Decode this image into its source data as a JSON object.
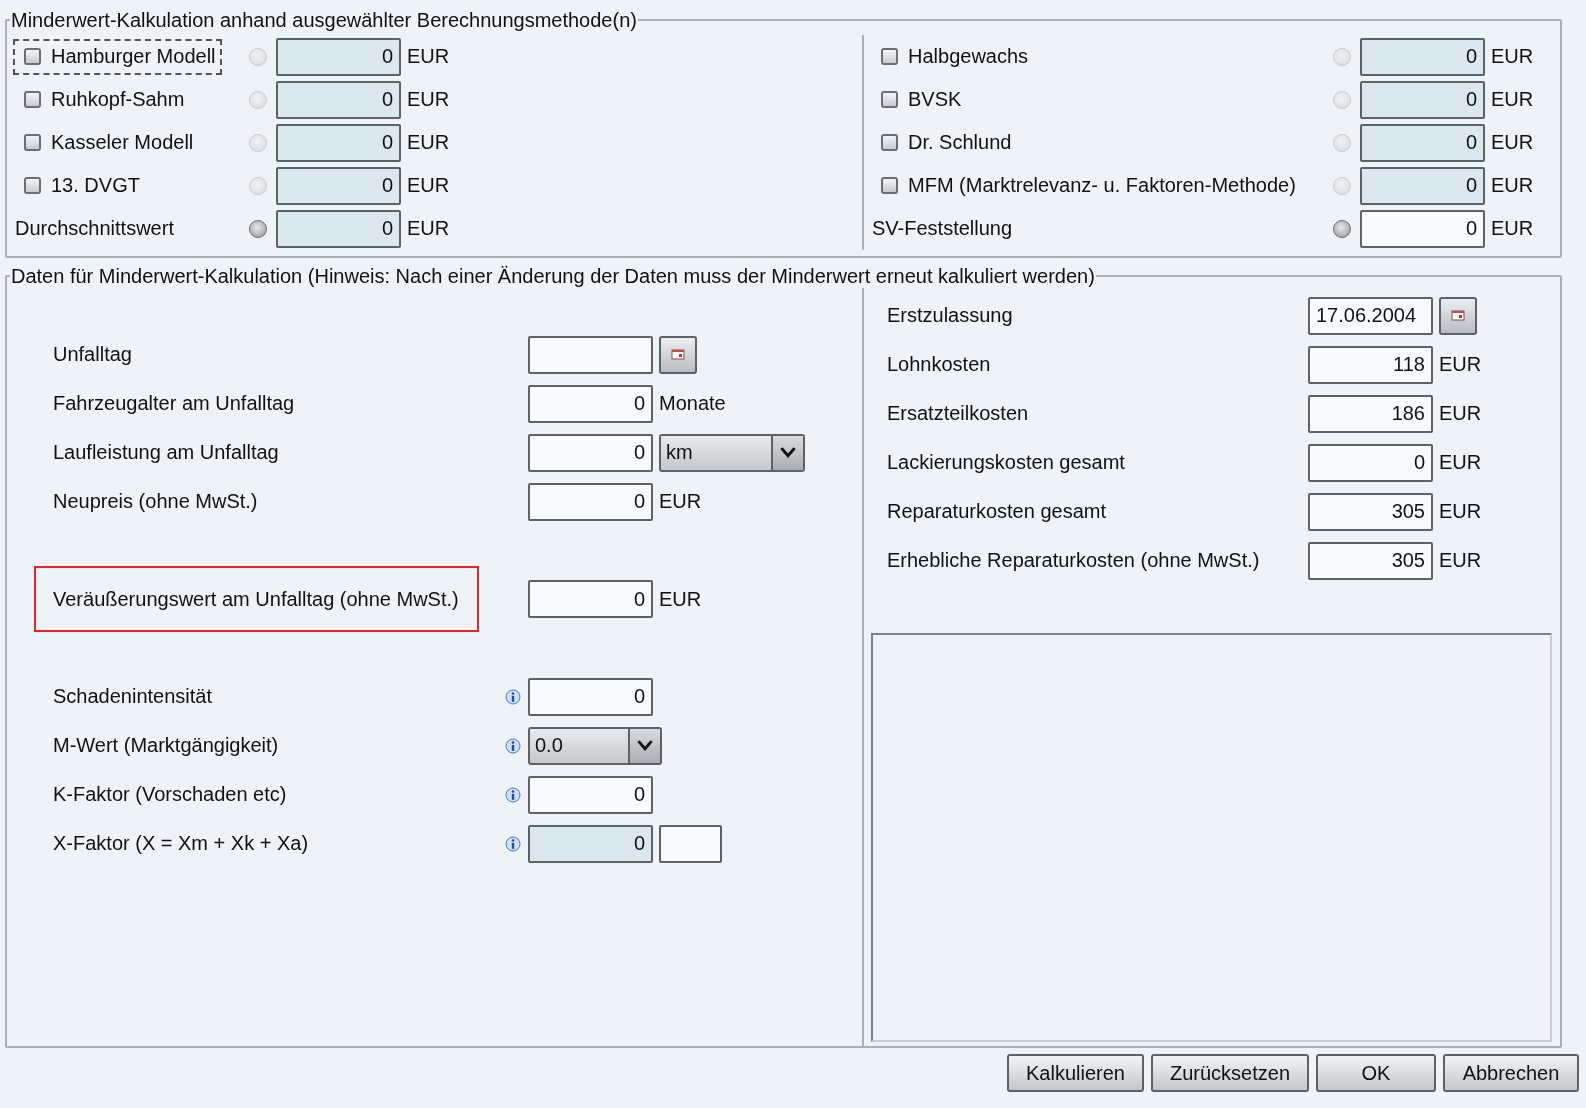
{
  "methods_group": {
    "title": "Minderwert-Kalkulation anhand ausgewählter Berechnungsmethode(n)",
    "columns": [
      [
        {
          "kind": "checkbox",
          "label": "Hamburger Modell",
          "checked": false,
          "focused": true,
          "radio_disabled": true,
          "value": "0",
          "readonly": true,
          "unit": "EUR"
        },
        {
          "kind": "checkbox",
          "label": "Ruhkopf-Sahm",
          "checked": false,
          "focused": false,
          "radio_disabled": true,
          "value": "0",
          "readonly": true,
          "unit": "EUR"
        },
        {
          "kind": "checkbox",
          "label": "Kasseler Modell",
          "checked": false,
          "focused": false,
          "radio_disabled": true,
          "value": "0",
          "readonly": true,
          "unit": "EUR"
        },
        {
          "kind": "checkbox",
          "label": "13. DVGT",
          "checked": false,
          "focused": false,
          "radio_disabled": true,
          "value": "0",
          "readonly": true,
          "unit": "EUR"
        },
        {
          "kind": "plain",
          "label": "Durchschnittswert",
          "radio_disabled": false,
          "value": "0",
          "readonly": true,
          "unit": "EUR"
        }
      ],
      [
        {
          "kind": "checkbox",
          "label": "Halbgewachs",
          "checked": false,
          "focused": false,
          "radio_disabled": true,
          "value": "0",
          "readonly": true,
          "unit": "EUR"
        },
        {
          "kind": "checkbox",
          "label": "BVSK",
          "checked": false,
          "focused": false,
          "radio_disabled": true,
          "value": "0",
          "readonly": true,
          "unit": "EUR"
        },
        {
          "kind": "checkbox",
          "label": "Dr. Schlund",
          "checked": false,
          "focused": false,
          "radio_disabled": true,
          "value": "0",
          "readonly": true,
          "unit": "EUR"
        },
        {
          "kind": "checkbox",
          "label": "MFM (Marktrelevanz- u. Faktoren-Methode)",
          "checked": false,
          "focused": false,
          "radio_disabled": true,
          "value": "0",
          "readonly": true,
          "unit": "EUR"
        },
        {
          "kind": "plain",
          "label": "SV-Feststellung",
          "radio_disabled": false,
          "value": "0",
          "readonly": false,
          "unit": "EUR"
        }
      ]
    ]
  },
  "data_group": {
    "title": "Daten für Minderwert-Kalkulation (Hinweis: Nach einer Änderung der Daten muss der Minderwert erneut kalkuliert werden)",
    "left_groups": [
      [
        {
          "kind": "date",
          "label": "Unfalltag",
          "highlighted": false
        },
        {
          "kind": "unit",
          "label": "Fahrzeugalter am Unfalltag",
          "highlighted": false,
          "value": "0",
          "unit": "Monate"
        },
        {
          "kind": "select_unit",
          "label": "Laufleistung am Unfalltag",
          "highlighted": false,
          "value": "0",
          "option": "km"
        },
        {
          "kind": "unit",
          "label": "Neupreis (ohne MwSt.)",
          "highlighted": false,
          "value": "0",
          "unit": "EUR"
        }
      ],
      [
        {
          "kind": "unit",
          "label": "Veräußerungswert am Unfalltag (ohne MwSt.)",
          "highlighted": true,
          "value": "0",
          "unit": "EUR"
        }
      ],
      [
        {
          "kind": "number",
          "label": "Schadenintensität",
          "info": true,
          "highlighted": false,
          "value": "0"
        },
        {
          "kind": "select",
          "label": "M-Wert (Marktgängigkeit)",
          "info": true,
          "highlighted": false,
          "option": "0.0"
        },
        {
          "kind": "number",
          "label": "K-Faktor (Vorschaden etc)",
          "info": true,
          "highlighted": false,
          "value": "0"
        },
        {
          "kind": "number_extra",
          "label": "X-Faktor (X = Xm + Xk + Xa)",
          "info": true,
          "highlighted": false,
          "readonly": true,
          "value": "0"
        }
      ]
    ],
    "right_rows": [
      {
        "kind": "date",
        "label": "Erstzulassung",
        "value": "17.06.2004"
      },
      {
        "kind": "unit",
        "label": "Lohnkosten",
        "value": "118",
        "unit": "EUR"
      },
      {
        "kind": "unit",
        "label": "Ersatzteilkosten",
        "value": "186",
        "unit": "EUR"
      },
      {
        "kind": "unit",
        "label": "Lackierungskosten gesamt",
        "value": "0",
        "unit": "EUR"
      },
      {
        "kind": "unit",
        "label": "Reparaturkosten gesamt",
        "value": "305",
        "unit": "EUR"
      },
      {
        "kind": "unit",
        "label": "Erhebliche Reparaturkosten (ohne MwSt.)",
        "value": "305",
        "unit": "EUR"
      }
    ]
  },
  "buttons": [
    "Kalkulieren",
    "Zurücksetzen",
    "OK",
    "Abbrechen"
  ]
}
